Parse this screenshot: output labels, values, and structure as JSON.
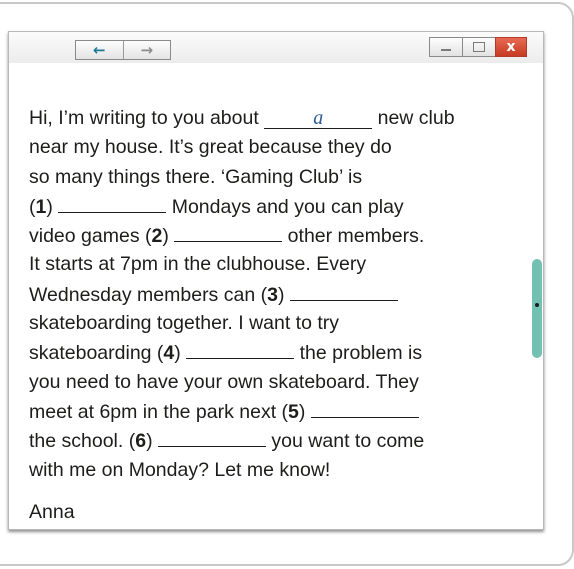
{
  "titlebar": {
    "back_icon": "←",
    "forward_icon": "→",
    "close_icon": "x"
  },
  "email": {
    "lines": [
      {
        "parts": [
          {
            "t": "text",
            "v": "Hi, I’m writing to you about "
          },
          {
            "t": "example",
            "v": "a"
          },
          {
            "t": "text",
            "v": " new club"
          }
        ]
      },
      {
        "parts": [
          {
            "t": "text",
            "v": "near my house. It’s great because they do"
          }
        ]
      },
      {
        "parts": [
          {
            "t": "text",
            "v": "so many things there. ‘Gaming Club’ is"
          }
        ]
      },
      {
        "parts": [
          {
            "t": "text",
            "v": "("
          },
          {
            "t": "num",
            "v": "1"
          },
          {
            "t": "text",
            "v": ") "
          },
          {
            "t": "blank"
          },
          {
            "t": "text",
            "v": " Mondays and you can play"
          }
        ]
      },
      {
        "parts": [
          {
            "t": "text",
            "v": "video games ("
          },
          {
            "t": "num",
            "v": "2"
          },
          {
            "t": "text",
            "v": ") "
          },
          {
            "t": "blank"
          },
          {
            "t": "text",
            "v": " other members."
          }
        ]
      },
      {
        "parts": [
          {
            "t": "text",
            "v": "It starts at 7pm in the clubhouse. Every"
          }
        ]
      },
      {
        "parts": [
          {
            "t": "text",
            "v": "Wednesday members can ("
          },
          {
            "t": "num",
            "v": "3"
          },
          {
            "t": "text",
            "v": ") "
          },
          {
            "t": "blank"
          }
        ]
      },
      {
        "parts": [
          {
            "t": "text",
            "v": "skateboarding together. I want to try"
          }
        ]
      },
      {
        "parts": [
          {
            "t": "text",
            "v": "skateboarding ("
          },
          {
            "t": "num",
            "v": "4"
          },
          {
            "t": "text",
            "v": ") "
          },
          {
            "t": "blank"
          },
          {
            "t": "text",
            "v": " the problem is"
          }
        ]
      },
      {
        "parts": [
          {
            "t": "text",
            "v": "you need to have your own skateboard. They"
          }
        ]
      },
      {
        "parts": [
          {
            "t": "text",
            "v": "meet at 6pm in the park next ("
          },
          {
            "t": "num",
            "v": "5"
          },
          {
            "t": "text",
            "v": ") "
          },
          {
            "t": "blank"
          }
        ]
      },
      {
        "parts": [
          {
            "t": "text",
            "v": "the school. ("
          },
          {
            "t": "num",
            "v": "6"
          },
          {
            "t": "text",
            "v": ") "
          },
          {
            "t": "blank"
          },
          {
            "t": "text",
            "v": " you want to come"
          }
        ]
      },
      {
        "parts": [
          {
            "t": "text",
            "v": "with me on Monday? Let me know!"
          }
        ]
      }
    ],
    "signature": "Anna"
  },
  "colors": {
    "scrollbar": "#73c1b3",
    "example_answer": "#2b5c96",
    "close_button": "#c63a22",
    "back_arrow": "#1a7a96"
  }
}
